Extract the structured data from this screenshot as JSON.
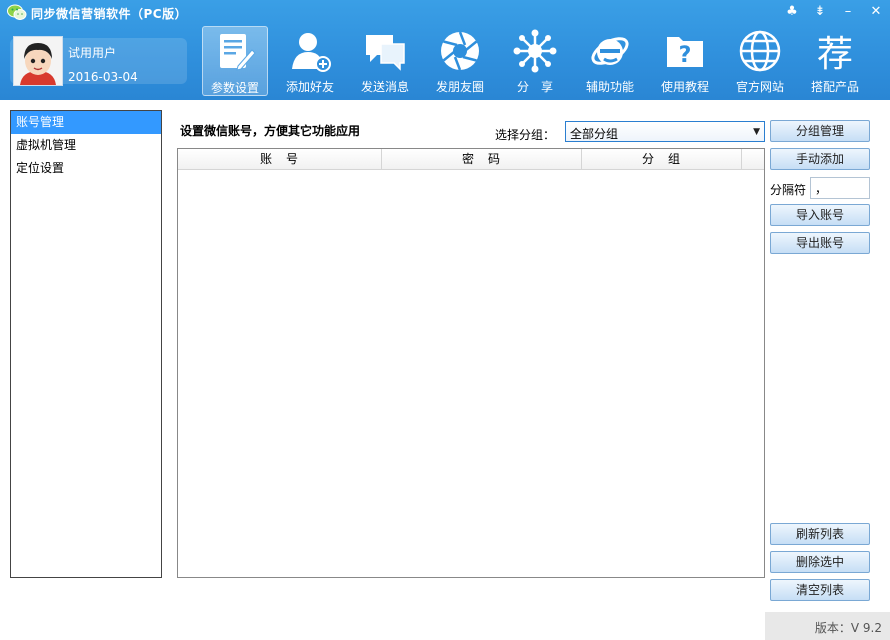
{
  "app": {
    "title": "同步微信营销软件（PC版）"
  },
  "window_controls": {
    "skin": "♣",
    "menu": "⇟",
    "minimize": "–",
    "close": "✕"
  },
  "user": {
    "name": "试用用户",
    "date": "2016-03-04"
  },
  "nav": [
    {
      "label": "参数设置",
      "icon": "document-edit-icon",
      "active": true
    },
    {
      "label": "添加好友",
      "icon": "add-user-icon"
    },
    {
      "label": "发送消息",
      "icon": "chat-bubbles-icon"
    },
    {
      "label": "发朋友圈",
      "icon": "aperture-icon"
    },
    {
      "label": "分　享",
      "icon": "share-network-icon"
    },
    {
      "label": "辅助功能",
      "icon": "ie-logo-icon"
    },
    {
      "label": "使用教程",
      "icon": "help-folder-icon"
    },
    {
      "label": "官方网站",
      "icon": "globe-icon"
    },
    {
      "label": "搭配产品",
      "icon": "recommend-glyph-icon",
      "glyph": "荐"
    }
  ],
  "sidebar": {
    "items": [
      {
        "label": "账号管理",
        "selected": true
      },
      {
        "label": "虚拟机管理"
      },
      {
        "label": "定位设置"
      }
    ]
  },
  "main": {
    "title": "设置微信账号，方便其它功能应用",
    "group_label": "选择分组：",
    "group_value": "全部分组",
    "table": {
      "columns": [
        "账　号",
        "密　码",
        "分　组"
      ],
      "rows": []
    }
  },
  "buttons": {
    "group_manage": "分组管理",
    "manual_add": "手动添加",
    "separator_label": "分隔符",
    "separator_value": "，",
    "import": "导入账号",
    "export": "导出账号",
    "refresh": "刷新列表",
    "delete_selected": "删除选中",
    "clear": "清空列表"
  },
  "status": {
    "version": "版本：V 9.2"
  },
  "colors": {
    "header": "#2f8fdc",
    "selection": "#3399ff",
    "button": "#c6def5"
  }
}
